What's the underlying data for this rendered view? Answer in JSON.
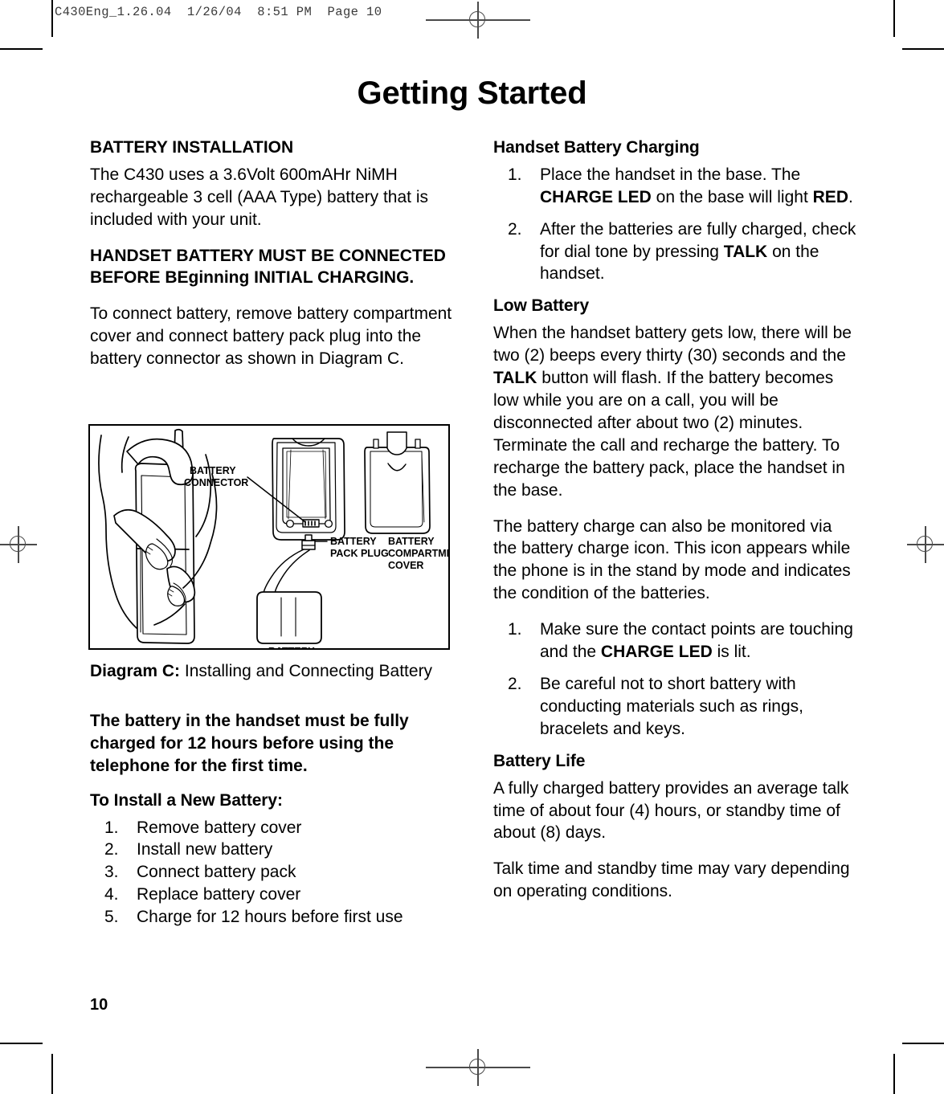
{
  "scan_header": "C430Eng_1.26.04  1/26/04  8:51 PM  Page 10",
  "page_title": "Getting Started",
  "page_number": "10",
  "left_column": {
    "heading_battery_installation": "BATTERY INSTALLATION",
    "intro_paragraph": "The C430 uses a 3.6Volt 600mAHr NiMH rechargeable 3 cell (AAA Type) battery that is included with your unit.",
    "warning_heading": "HANDSET BATTERY MUST BE CONNECTED BEFORE BEginning INITIAL CHARGING.",
    "connect_paragraph": "To connect battery, remove battery compartment cover and connect battery pack plug into the battery connector as shown in Diagram C.",
    "caption_label": "Diagram C:",
    "caption_text": " Installing and Connecting Battery",
    "charge_notice": "The battery in the handset must be fully charged for 12 hours before using the telephone for the first time.",
    "install_heading": "To Install a New Battery:",
    "install_steps": [
      {
        "num": "1.",
        "text": "Remove battery cover"
      },
      {
        "num": "2.",
        "text": "Install new battery"
      },
      {
        "num": "3.",
        "text": "Connect battery pack"
      },
      {
        "num": "4.",
        "text": "Replace battery cover"
      },
      {
        "num": "5.",
        "text": "Charge for 12 hours before first use"
      }
    ]
  },
  "right_column": {
    "heading_handset_charging": "Handset Battery Charging",
    "charging_steps": [
      {
        "num": "1.",
        "parts": [
          {
            "text": "Place the handset in the base. The ",
            "bold": false
          },
          {
            "text": "CHARGE LED",
            "bold": true
          },
          {
            "text": " on the base will light ",
            "bold": false
          },
          {
            "text": "RED",
            "bold": true
          },
          {
            "text": ".",
            "bold": false
          }
        ]
      },
      {
        "num": "2.",
        "parts": [
          {
            "text": "After the batteries are fully charged, check for dial tone by pressing ",
            "bold": false
          },
          {
            "text": "TALK",
            "bold": true
          },
          {
            "text": " on the handset.",
            "bold": false
          }
        ]
      }
    ],
    "heading_low_battery": "Low Battery",
    "low_battery_paragraph": [
      {
        "text": "When the handset battery gets low, there will be two (2) beeps every thirty (30) seconds and the ",
        "bold": false
      },
      {
        "text": "TALK",
        "bold": true
      },
      {
        "text": " button will flash. If the battery becomes low while you are on a call, you will be disconnected after about two (2) minutes. Terminate the call and recharge the battery. To recharge the battery pack, place the handset in the base.",
        "bold": false
      }
    ],
    "monitor_paragraph": "The battery charge can also be monitored via the battery charge icon. This icon appears while the phone is in the stand by mode and indicates the condition of the batteries.",
    "care_steps": [
      {
        "num": "1.",
        "parts": [
          {
            "text": "Make sure the contact points are touching and the ",
            "bold": false
          },
          {
            "text": "CHARGE LED",
            "bold": true
          },
          {
            "text": " is lit.",
            "bold": false
          }
        ]
      },
      {
        "num": "2.",
        "parts": [
          {
            "text": "Be careful not to short battery with conducting materials such as rings, bracelets and keys.",
            "bold": false
          }
        ]
      }
    ],
    "heading_battery_life": "Battery Life",
    "battery_life_paragraph": "A fully charged battery provides an average talk time of about four (4) hours, or standby time of about (8) days.",
    "vary_paragraph": "Talk time and standby time may vary depending on operating conditions."
  },
  "diagram": {
    "labels": {
      "battery_connector": "BATTERY\nCONNECTOR",
      "battery_connector_line1": "BATTERY",
      "battery_connector_line2": "CONNECTOR",
      "battery_pack_plug_line1": "BATTERY",
      "battery_pack_plug_line2": "PACK PLUG",
      "battery_compartment_cover_line1": "BATTERY",
      "battery_compartment_cover_line2": "COMPARTMENT",
      "battery_compartment_cover_line3": "COVER",
      "battery": "BATTERY"
    }
  }
}
